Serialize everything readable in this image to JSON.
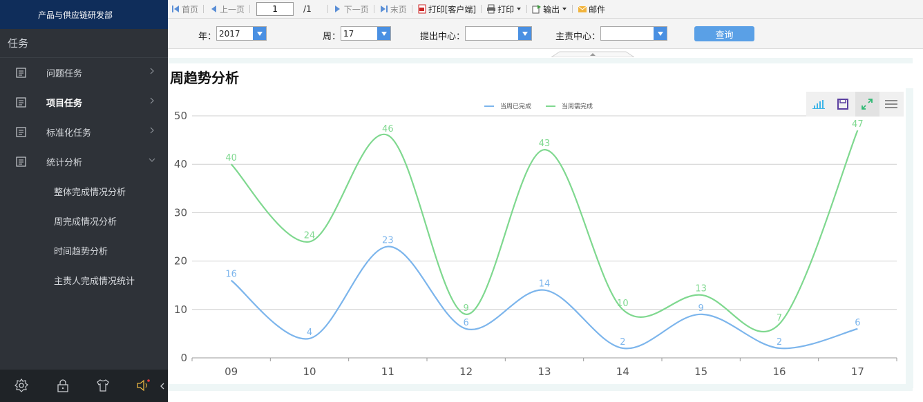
{
  "sidebar": {
    "org_name": "产品与供应链研发部",
    "title": "任务",
    "items": [
      {
        "label": "问题任务",
        "bold": false
      },
      {
        "label": "项目任务",
        "bold": true
      },
      {
        "label": "标准化任务",
        "bold": false
      },
      {
        "label": "统计分析",
        "bold": false,
        "expanded": true
      }
    ],
    "sub_items": [
      {
        "label": "整体完成情况分析"
      },
      {
        "label": "周完成情况分析"
      },
      {
        "label": "时间趋势分析"
      },
      {
        "label": "主责人完成情况统计"
      }
    ]
  },
  "toolbar": {
    "first_page": "首页",
    "prev_page": "上一页",
    "page_value": "1",
    "page_total": "/1",
    "next_page": "下一页",
    "last_page": "末页",
    "print_client": "打印[客户端]",
    "print": "打印",
    "export": "输出",
    "mail": "邮件"
  },
  "filters": {
    "year_label": "年：",
    "year_value": "2017",
    "week_label": "周：",
    "week_value": "17",
    "submit_center_label": "提出中心：",
    "submit_center_value": "",
    "owner_center_label": "主责中心：",
    "owner_center_value": "",
    "query_label": "查询"
  },
  "content": {
    "title": "周趋势分析"
  },
  "colors": {
    "series_completed": "#7cb5ec",
    "series_required": "#7fd88f",
    "sidebar_bg": "#2e3238",
    "org_bar_bg": "#0f2d5a",
    "accent_blue": "#4a90e2"
  },
  "chart_tools": [
    "bar-chart-icon",
    "save-icon",
    "fullscreen-icon",
    "menu-icon"
  ],
  "chart_data": {
    "type": "line",
    "smooth": true,
    "title": "",
    "xlabel": "",
    "ylabel": "",
    "categories": [
      "09",
      "10",
      "11",
      "12",
      "13",
      "14",
      "15",
      "16",
      "17"
    ],
    "ylim": [
      0,
      50
    ],
    "yticks": [
      0,
      10,
      20,
      30,
      40,
      50
    ],
    "grid": true,
    "legend_position": "top-center",
    "series": [
      {
        "name": "当周已完成",
        "values": [
          16,
          4,
          23,
          6,
          14,
          2,
          9,
          2,
          6
        ]
      },
      {
        "name": "当周需完成",
        "values": [
          40,
          24,
          46,
          9,
          43,
          10,
          13,
          7,
          47
        ]
      }
    ]
  }
}
